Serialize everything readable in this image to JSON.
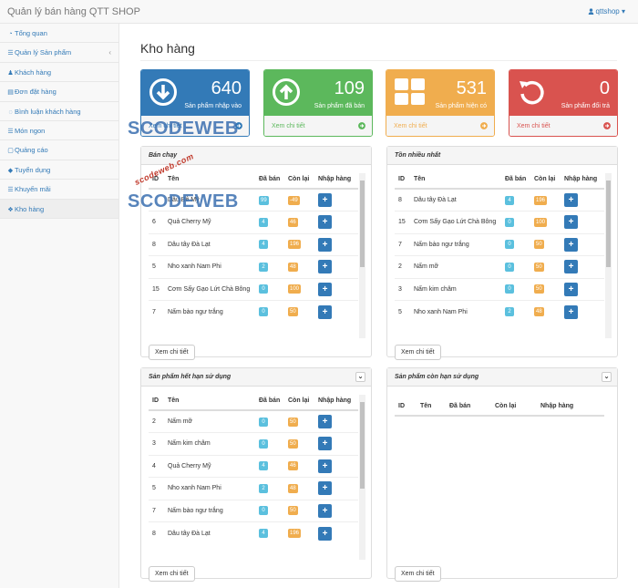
{
  "app": {
    "title": "Quản lý bán hàng QTT SHOP",
    "user": "qttshop ▾"
  },
  "sidebar": {
    "items": [
      {
        "label": "Tổng quan",
        "icon": "dashboard-icon"
      },
      {
        "label": "Quản lý Sản phẩm",
        "icon": "list-icon"
      },
      {
        "label": "Khách hàng",
        "icon": "users-icon"
      },
      {
        "label": "Đơn đặt hàng",
        "icon": "cart-icon"
      },
      {
        "label": "Bình luận khách hàng",
        "icon": "comments-icon"
      },
      {
        "label": "Món ngon",
        "icon": "list-icon"
      },
      {
        "label": "Quảng cáo",
        "icon": "square-icon"
      },
      {
        "label": "Tuyển dụng",
        "icon": "tag-icon"
      },
      {
        "label": "Khuyến mãi",
        "icon": "list-icon"
      },
      {
        "label": "Kho hàng",
        "icon": "cubes-icon"
      }
    ]
  },
  "page": {
    "title": "Kho hàng"
  },
  "cards": [
    {
      "value": "640",
      "caption": "Sản phẩm nhập vào",
      "link": "Xem chi tiết",
      "color": "#337ab7",
      "icon": "arrow-down-circle-icon"
    },
    {
      "value": "109",
      "caption": "Sản phẩm đã bán",
      "link": "Xem chi tiết",
      "color": "#5cb85c",
      "icon": "arrow-up-circle-icon"
    },
    {
      "value": "531",
      "caption": "Sản phẩm hiện có",
      "link": "Xem chi tiết",
      "color": "#f0ad4e",
      "icon": "grid-icon"
    },
    {
      "value": "0",
      "caption": "Sản phẩm đổi trả",
      "link": "Xem chi tiết",
      "color": "#d9534f",
      "icon": "undo-icon"
    }
  ],
  "columns": {
    "id": "ID",
    "name": "Tên",
    "sold": "Đã bán",
    "left": "Còn lại",
    "import": "Nhập hàng"
  },
  "panels": {
    "best_selling": {
      "title": "Bán chạy",
      "button": "Xem chi tiết",
      "rows": [
        {
          "id": "",
          "name": "Dâu Bê Mỹ",
          "sold": "99",
          "left": "-49"
        },
        {
          "id": "6",
          "name": "Quả Cherry Mỹ",
          "sold": "4",
          "left": "46"
        },
        {
          "id": "8",
          "name": "Dâu tây Đà Lạt",
          "sold": "4",
          "left": "196"
        },
        {
          "id": "5",
          "name": "Nho xanh Nam Phi",
          "sold": "2",
          "left": "48"
        },
        {
          "id": "15",
          "name": "Cơm Sấy Gạo Lứt Chà Bông",
          "sold": "0",
          "left": "100"
        },
        {
          "id": "7",
          "name": "Nấm bào ngư trắng",
          "sold": "0",
          "left": "50"
        }
      ]
    },
    "most_stock": {
      "title": "Tồn nhiều nhất",
      "button": "Xem chi tiết",
      "rows": [
        {
          "id": "8",
          "name": "Dâu tây Đà Lạt",
          "sold": "4",
          "left": "196"
        },
        {
          "id": "15",
          "name": "Cơm Sấy Gạo Lứt Chà Bông",
          "sold": "0",
          "left": "100"
        },
        {
          "id": "7",
          "name": "Nấm bào ngư trắng",
          "sold": "0",
          "left": "50"
        },
        {
          "id": "2",
          "name": "Nấm mỡ",
          "sold": "0",
          "left": "50"
        },
        {
          "id": "3",
          "name": "Nấm kim châm",
          "sold": "0",
          "left": "50"
        },
        {
          "id": "5",
          "name": "Nho xanh Nam Phi",
          "sold": "2",
          "left": "48"
        }
      ]
    },
    "expired": {
      "title": "Sản phẩm hết hạn sử dụng",
      "button": "Xem chi tiết",
      "rows": [
        {
          "id": "2",
          "name": "Nấm mỡ",
          "sold": "0",
          "left": "50"
        },
        {
          "id": "3",
          "name": "Nấm kim châm",
          "sold": "0",
          "left": "50"
        },
        {
          "id": "4",
          "name": "Quả Cherry Mỹ",
          "sold": "4",
          "left": "46"
        },
        {
          "id": "5",
          "name": "Nho xanh Nam Phi",
          "sold": "2",
          "left": "48"
        },
        {
          "id": "7",
          "name": "Nấm bào ngư trắng",
          "sold": "0",
          "left": "50"
        },
        {
          "id": "8",
          "name": "Dâu tây Đà Lạt",
          "sold": "4",
          "left": "196"
        }
      ]
    },
    "valid": {
      "title": "Sản phẩm còn hạn sử dụng",
      "button": "Xem chi tiết",
      "rows": []
    }
  },
  "watermark": {
    "brand": "SCODEWEB",
    "url": "scodeweb.com"
  }
}
